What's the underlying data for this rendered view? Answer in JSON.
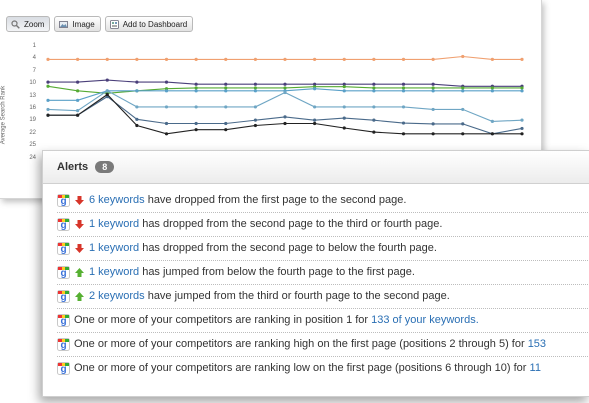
{
  "toolbar": {
    "zoom_label": "Zoom",
    "image_label": "Image",
    "dashboard_label": "Add to Dashboard"
  },
  "chart_data": {
    "type": "line",
    "ylabel": "Average Search Rank",
    "y_ticks": [
      "1",
      "4",
      "7",
      "10",
      "13",
      "16",
      "19",
      "22",
      "25",
      "24"
    ],
    "x_count": 17,
    "series": [
      {
        "color": "#f0a070",
        "values": [
          4,
          4,
          4,
          4,
          4,
          4,
          4,
          4,
          4,
          4,
          4,
          4,
          4,
          4,
          3.3,
          4,
          4,
          3.8
        ]
      },
      {
        "color": "#4a3f7a",
        "values": [
          9.5,
          9.5,
          9,
          9.5,
          9.5,
          10,
          10,
          10,
          10,
          10,
          10,
          10,
          10,
          10,
          10.5,
          10.5,
          10.5
        ]
      },
      {
        "color": "#55aa33",
        "values": [
          10.5,
          11.6,
          12.2,
          11.6,
          11.1,
          10.9,
          10.9,
          10.9,
          10.9,
          10.6,
          10.6,
          10.9,
          10.9,
          10.9,
          10.9,
          10.9,
          10.9
        ]
      },
      {
        "color": "#5aa0c8",
        "values": [
          13.9,
          13.9,
          11.6,
          11.6,
          11.6,
          11.6,
          11.6,
          11.6,
          11.6,
          11.1,
          11.6,
          11.6,
          11.6,
          11.6,
          11.6,
          11.6,
          11.6
        ]
      },
      {
        "color": "#6fa6c4",
        "values": [
          16.1,
          16.4,
          11.6,
          15.5,
          15.5,
          15.5,
          15.5,
          15.5,
          12.0,
          15.5,
          15.5,
          15.5,
          15.5,
          16.1,
          16.1,
          19,
          18.7
        ]
      },
      {
        "color": "#4a6a8a",
        "values": [
          17.5,
          17.5,
          13.0,
          18.5,
          19.5,
          19.5,
          19.5,
          18.7,
          17.9,
          18.7,
          18.2,
          18.7,
          19.4,
          19.6,
          19.6,
          22,
          20.7
        ]
      },
      {
        "color": "#222222",
        "values": [
          17.5,
          17.5,
          12.5,
          20,
          22,
          21,
          21,
          20,
          19.5,
          19.5,
          20.6,
          21.6,
          22,
          22,
          22,
          22,
          22
        ]
      }
    ]
  },
  "alerts": {
    "title": "Alerts",
    "count": "8",
    "items": [
      {
        "arrow": "down",
        "link": "6 keywords",
        "text": " have dropped from the first page to the second page.",
        "tail": ""
      },
      {
        "arrow": "down",
        "link": "1 keyword",
        "text": " has dropped from the second page to the third or fourth page.",
        "tail": ""
      },
      {
        "arrow": "down",
        "link": "1 keyword",
        "text": " has dropped from the second page to below the fourth page.",
        "tail": ""
      },
      {
        "arrow": "up",
        "link": "1 keyword",
        "text": " has jumped from below the fourth page to the first page.",
        "tail": ""
      },
      {
        "arrow": "up",
        "link": "2 keywords",
        "text": " have jumped from the third or fourth page to the second page.",
        "tail": ""
      },
      {
        "arrow": "none",
        "link": "",
        "text": "One or more of your competitors are ranking in position 1 for ",
        "tail": "133 of your keywords."
      },
      {
        "arrow": "none",
        "link": "",
        "text": "One or more of your competitors are ranking high on the first page (positions 2 through 5) for ",
        "tail": "153"
      },
      {
        "arrow": "none",
        "link": "",
        "text": "One or more of your competitors are ranking low on the first page (positions 6 through 10) for ",
        "tail": "11"
      }
    ]
  },
  "colors": {
    "link": "#2a6fb4",
    "down_arrow": "#d7352a",
    "up_arrow": "#56b032"
  }
}
